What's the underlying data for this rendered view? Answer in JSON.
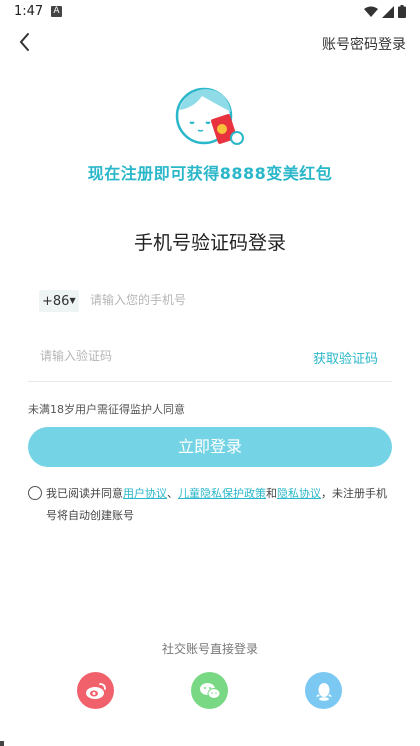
{
  "status_bar": {
    "time": "1:47",
    "notification_letter": "A"
  },
  "nav": {
    "right_link": "账号密码登录"
  },
  "promo": {
    "text": "现在注册即可获得8888变美红包"
  },
  "title": "手机号验证码登录",
  "phone": {
    "country_code": "+86",
    "placeholder": "请输入您的手机号"
  },
  "code": {
    "placeholder": "请输入验证码",
    "get_code_label": "获取验证码"
  },
  "minor_note": "未满18岁用户需征得监护人同意",
  "login_button": "立即登录",
  "agreement": {
    "prefix": "我已阅读并同意",
    "link1": "用户协议",
    "sep1": "、",
    "link2": "儿童隐私保护政策",
    "sep2": "和",
    "link3": "隐私协议",
    "suffix": "，未注册手机号将自动创建账号"
  },
  "social": {
    "title": "社交账号直接登录",
    "items": [
      "weibo-icon",
      "wechat-icon",
      "qq-icon"
    ]
  },
  "colors": {
    "accent": "#2ab7c9",
    "button": "#74d3e4",
    "weibo": "#f0616b",
    "wechat": "#79d883",
    "qq": "#7bc9f3"
  }
}
